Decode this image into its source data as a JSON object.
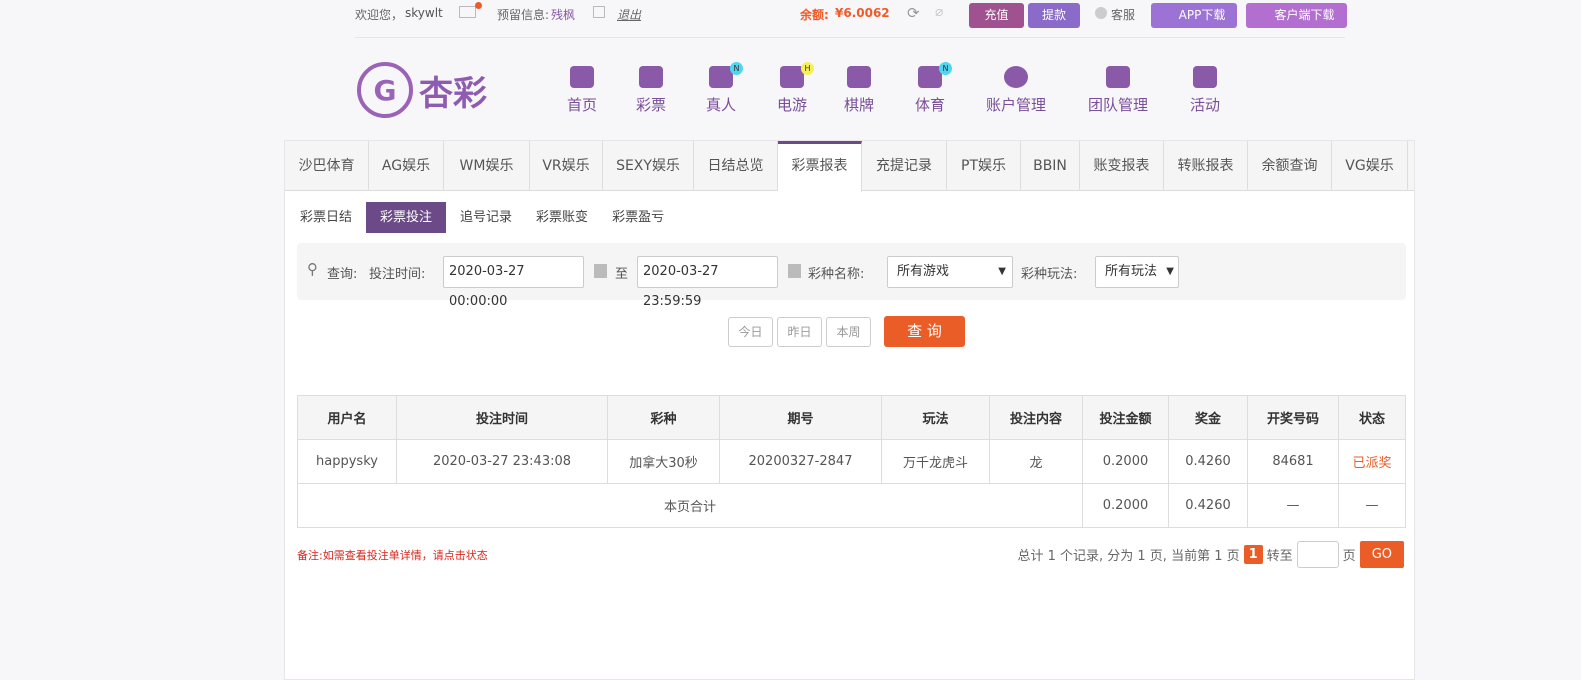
{
  "topbar": {
    "welcome": "欢迎您，",
    "username": "skywlt",
    "reserved_label": "预留信息:",
    "reserved_value": "残枫",
    "logout": "退出",
    "balance_label": "余额:",
    "balance": "¥6.0062",
    "deposit": "充值",
    "withdraw": "提款",
    "service": "客服",
    "app_download": "APP下载",
    "client_download": "客户端下载"
  },
  "logo": {
    "text": "杏彩"
  },
  "nav": [
    {
      "label": "首页"
    },
    {
      "label": "彩票"
    },
    {
      "label": "真人",
      "badge": "N"
    },
    {
      "label": "电游",
      "badge": "H"
    },
    {
      "label": "棋牌"
    },
    {
      "label": "体育",
      "badge": "N"
    },
    {
      "label": "账户管理"
    },
    {
      "label": "团队管理"
    },
    {
      "label": "活动"
    }
  ],
  "tabs": [
    "沙巴体育",
    "AG娱乐",
    "WM娱乐",
    "VR娱乐",
    "SEXY娱乐",
    "日结总览",
    "彩票报表",
    "充提记录",
    "PT娱乐",
    "BBIN",
    "账变报表",
    "转账报表",
    "余额查询",
    "VG娱乐"
  ],
  "subtabs": [
    "彩票日结",
    "彩票投注",
    "追号记录",
    "彩票账变",
    "彩票盈亏"
  ],
  "filter": {
    "query_label": "查询:",
    "time_label": "投注时间:",
    "start": "2020-03-27 00:00:00",
    "to": "至",
    "end": "2020-03-27 23:59:59",
    "game_label": "彩种名称:",
    "game_value": "所有游戏",
    "play_label": "彩种玩法:",
    "play_value": "所有玩法"
  },
  "quick": {
    "today": "今日",
    "yesterday": "昨日",
    "week": "本周",
    "search": "查 询"
  },
  "table": {
    "headers": [
      "用户名",
      "投注时间",
      "彩种",
      "期号",
      "玩法",
      "投注内容",
      "投注金额",
      "奖金",
      "开奖号码",
      "状态"
    ],
    "rows": [
      [
        "happysky",
        "2020-03-27 23:43:08",
        "加拿大30秒",
        "20200327-2847",
        "万千龙虎斗",
        "龙",
        "0.2000",
        "0.4260",
        "84681",
        "已派奖"
      ]
    ],
    "total": {
      "label": "本页合计",
      "amount": "0.2000",
      "bonus": "0.4260",
      "number": "—",
      "status": "—"
    }
  },
  "footer": {
    "note": "备注:如需查看投注单详情，请点击状态",
    "summary": "总计 1 个记录, 分为 1 页, 当前第 1 页",
    "page": "1",
    "goto": "转至",
    "page_unit": "页",
    "go": "GO"
  },
  "colors": {
    "accent": "#6b4a87",
    "orange": "#ea5d27",
    "status": "#ea5d27"
  }
}
